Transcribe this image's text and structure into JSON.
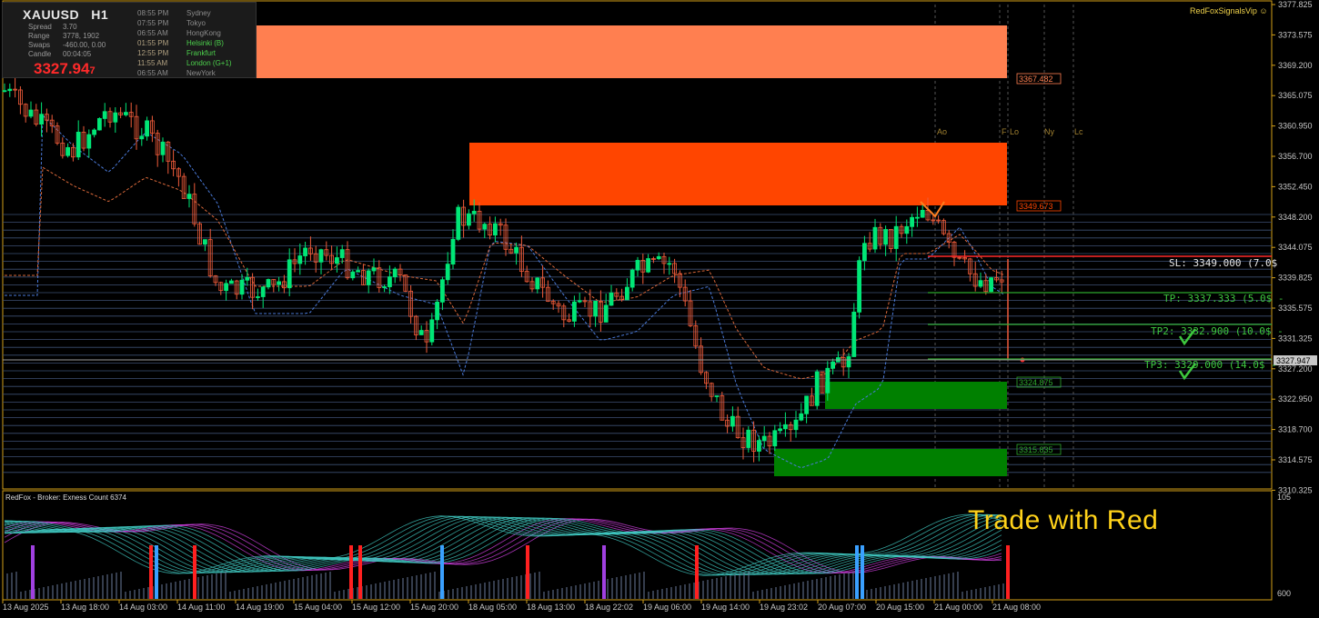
{
  "symbol": "XAUUSD",
  "timeframe": "H1",
  "info": {
    "spread_label": "Spread",
    "spread": "3.70",
    "range_label": "Range",
    "range": "3778, 1902",
    "swaps_label": "Swaps",
    "swaps": "-460.00, 0.00",
    "candle_label": "Candle",
    "candle": "00:04:05",
    "price_main": "3327.94",
    "price_last": "7"
  },
  "sessions": [
    {
      "time": "08:55 PM",
      "name": "Sydney",
      "state": "closed"
    },
    {
      "time": "07:55 PM",
      "name": "Tokyo",
      "state": "closed"
    },
    {
      "time": "06:55 AM",
      "name": "HongKong",
      "state": "closed"
    },
    {
      "time": "01:55 PM",
      "name": "Helsinki  (B)",
      "state": "open"
    },
    {
      "time": "12:55 PM",
      "name": "Frankfurt",
      "state": "open"
    },
    {
      "time": "11:55 AM",
      "name": "London  (G+1)",
      "state": "open"
    },
    {
      "time": "06:55 AM",
      "name": "NewYork",
      "state": "closed"
    }
  ],
  "brand": "RedFoxSignalsVip",
  "trade_text": "Trade with Red",
  "indicator_label": "RedFox -  Broker: Exness    Count  6374",
  "session_markers": [
    "Ao",
    "F",
    "Lo",
    "Ny",
    "Lc"
  ],
  "zone_labels": {
    "z1": "3367.482",
    "z2": "3349.673",
    "z3": "3324.875",
    "z4": "3315.835"
  },
  "trade_levels": {
    "sl": "SL: 3349.000 (7.0$",
    "tp1": "TP: 3337.333 (5.0$ -",
    "tp2": "TP2: 3332.900 (10.0$ -",
    "tp3": "TP3: 3329.000 (14.0$ -"
  },
  "current_price_tag": "3327.947",
  "price_axis": [
    "3377.825",
    "3373.575",
    "3369.200",
    "3365.075",
    "3360.950",
    "3356.700",
    "3352.450",
    "3348.200",
    "3344.075",
    "3339.825",
    "3335.575",
    "3331.325",
    "3327.200",
    "3322.950",
    "3318.700",
    "3314.575",
    "3310.325"
  ],
  "indicator_axis": {
    "top": "105",
    "bottom": "600"
  },
  "time_axis": [
    "13 Aug 2025",
    "13 Aug 18:00",
    "14 Aug 03:00",
    "14 Aug 11:00",
    "14 Aug 19:00",
    "15 Aug 04:00",
    "15 Aug 12:00",
    "15 Aug 20:00",
    "18 Aug 05:00",
    "18 Aug 13:00",
    "18 Aug 22:02",
    "19 Aug 06:00",
    "19 Aug 14:00",
    "19 Aug 23:02",
    "20 Aug 07:00",
    "20 Aug 15:00",
    "21 Aug 00:00",
    "21 Aug 08:00"
  ],
  "colors": {
    "up": "#00e676",
    "down": "#ef5b3a",
    "zone_top": "#ff7f50",
    "zone_mid": "#ff4500",
    "zone_green": "#008000",
    "axis_gold": "#d4a017",
    "sl": "#ff2a2a",
    "tp": "#2ea82e"
  }
}
